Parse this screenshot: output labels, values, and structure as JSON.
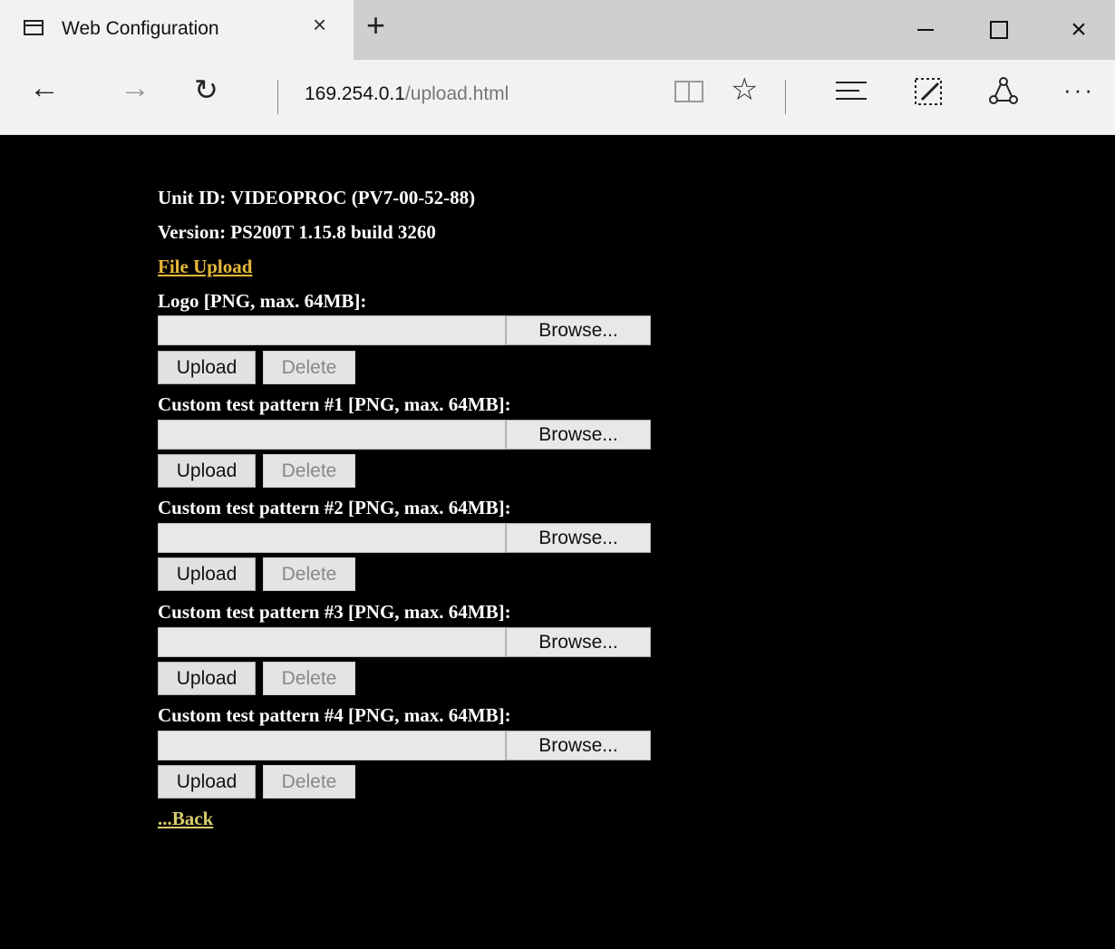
{
  "browser": {
    "tab_title": "Web Configuration",
    "tab_close": "×",
    "new_tab": "+",
    "window_close": "×",
    "url_host": "169.254.0.1",
    "url_path": "/upload.html",
    "back": "←",
    "forward": "→",
    "refresh": "↻",
    "favorite": "☆",
    "more": "···"
  },
  "page": {
    "unit_id": "Unit ID: VIDEOPROC (PV7-00-52-88)",
    "version": "Version: PS200T 1.15.8 build 3260",
    "section_link": "File Upload",
    "back_link": "...Back",
    "browse_label": "Browse...",
    "upload_label": "Upload",
    "delete_label": "Delete",
    "uploads": [
      {
        "label": "Logo [PNG, max. 64MB]:"
      },
      {
        "label": "Custom test pattern #1 [PNG, max. 64MB]:"
      },
      {
        "label": "Custom test pattern #2 [PNG, max. 64MB]:"
      },
      {
        "label": "Custom test pattern #3 [PNG, max. 64MB]:"
      },
      {
        "label": "Custom test pattern #4 [PNG, max. 64MB]:"
      }
    ]
  },
  "colors": {
    "background": "#000000",
    "link_gold": "#e6b73a",
    "link_back": "#d8cc6e"
  }
}
